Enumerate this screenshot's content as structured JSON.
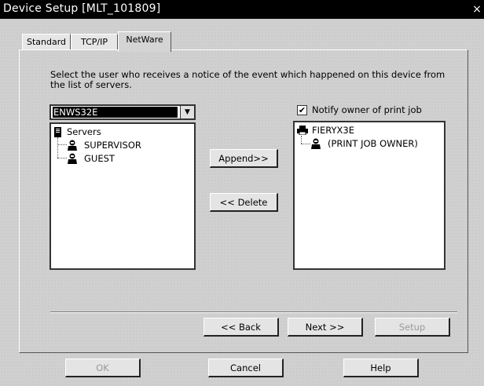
{
  "window": {
    "title": "Device Setup [MLT_101809]",
    "close_symbol": "×"
  },
  "tabs": [
    {
      "label": "Standard"
    },
    {
      "label": "TCP/IP"
    },
    {
      "label": "NetWare"
    }
  ],
  "instruction": "Select the user who receives a notice of the event which happened on this device from the list of servers.",
  "server_select": {
    "value": "ENWS32E"
  },
  "server_tree": {
    "root": "Servers",
    "items": [
      "SUPERVISOR",
      "GUEST"
    ]
  },
  "buttons": {
    "append": "Append>>",
    "delete": "<< Delete",
    "back": "<< Back",
    "next": "Next >>",
    "setup": "Setup",
    "ok": "OK",
    "cancel": "Cancel",
    "help": "Help"
  },
  "notify": {
    "label": "Notify owner of print job",
    "checked": true,
    "mark": "✔"
  },
  "target_tree": {
    "root": "FIERYX3E",
    "items": [
      "(PRINT JOB OWNER)"
    ]
  }
}
